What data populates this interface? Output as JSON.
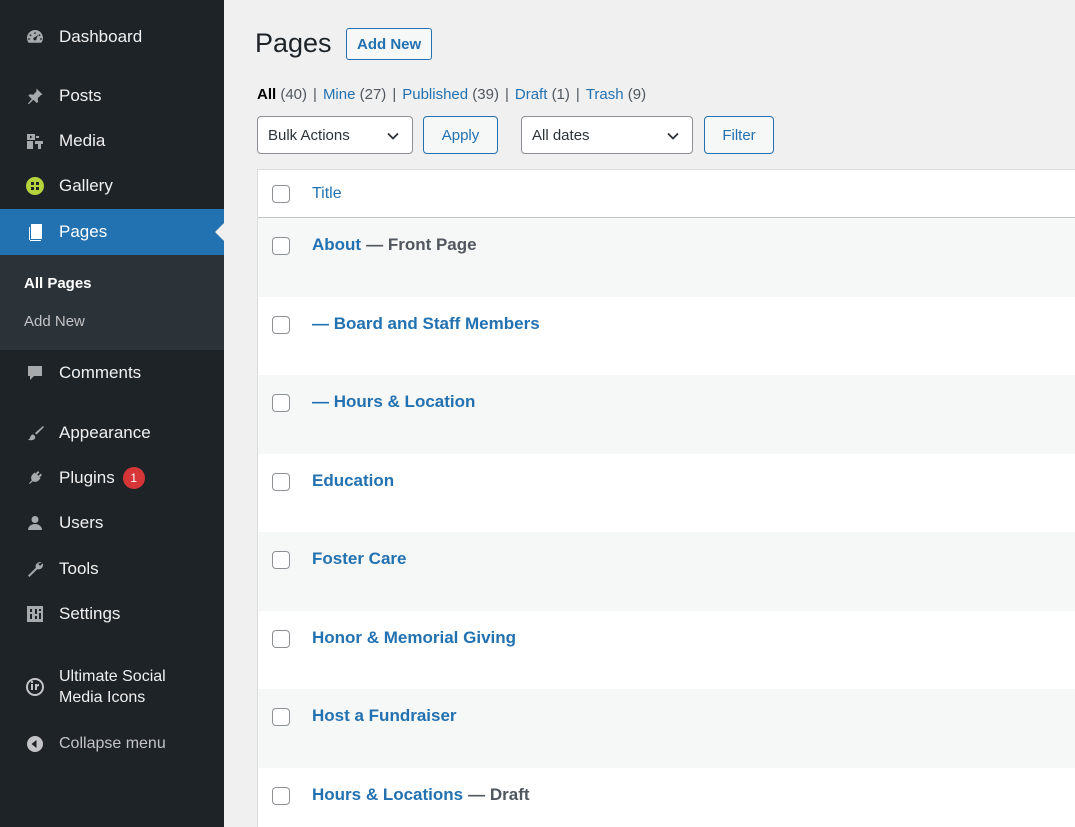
{
  "sidebar": {
    "items": [
      {
        "label": "Dashboard",
        "icon": "dashboard-icon"
      },
      {
        "label": "Posts",
        "icon": "pin-icon"
      },
      {
        "label": "Media",
        "icon": "media-icon"
      },
      {
        "label": "Gallery",
        "icon": "gallery-icon"
      },
      {
        "label": "Pages",
        "icon": "pages-icon"
      },
      {
        "label": "Comments",
        "icon": "comment-icon"
      },
      {
        "label": "Appearance",
        "icon": "brush-icon"
      },
      {
        "label": "Plugins",
        "icon": "plugin-icon",
        "badge": "1"
      },
      {
        "label": "Users",
        "icon": "user-icon"
      },
      {
        "label": "Tools",
        "icon": "wrench-icon"
      },
      {
        "label": "Settings",
        "icon": "settings-icon"
      },
      {
        "label_line1": "Ultimate Social",
        "label_line2": "Media Icons",
        "icon": "social-icons-icon"
      }
    ],
    "submenu": [
      "All Pages",
      "Add New"
    ],
    "collapse_label": "Collapse menu"
  },
  "main": {
    "title": "Pages",
    "add_new_label": "Add New",
    "filters": [
      {
        "label": "All",
        "count": "(40)"
      },
      {
        "label": "Mine",
        "count": "(27)"
      },
      {
        "label": "Published",
        "count": "(39)"
      },
      {
        "label": "Draft",
        "count": "(1)"
      },
      {
        "label": "Trash",
        "count": "(9)"
      }
    ],
    "filter_separator": "|",
    "bulk_actions": "Bulk Actions",
    "apply_label": "Apply",
    "dates": "All dates",
    "filter_label": "Filter",
    "table": {
      "column_title": "Title",
      "rows": [
        {
          "title": "About",
          "state": "— Front Page"
        },
        {
          "title": "— Board and Staff Members",
          "state": ""
        },
        {
          "title": "— Hours & Location",
          "state": ""
        },
        {
          "title": "Education",
          "state": ""
        },
        {
          "title": "Foster Care",
          "state": ""
        },
        {
          "title": "Honor & Memorial Giving",
          "state": ""
        },
        {
          "title": "Host a Fundraiser",
          "state": ""
        },
        {
          "title": "Hours & Locations",
          "state": "— Draft"
        }
      ]
    }
  },
  "colors": {
    "sidebar_bg": "#1d2327",
    "submenu_bg": "#2c3338",
    "accent": "#2271b1",
    "badge": "#d63638"
  }
}
